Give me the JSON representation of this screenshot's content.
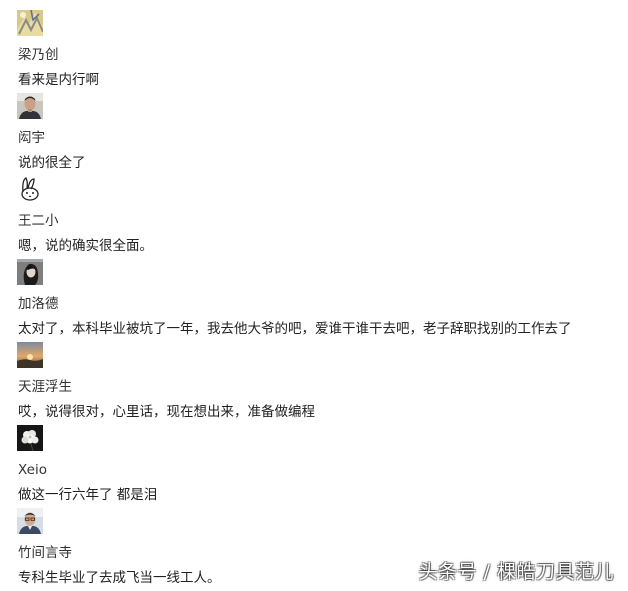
{
  "comments": [
    {
      "username": "梁乃创",
      "text": "看来是内行啊",
      "avatar_icon": "yellow-pattern-avatar-icon"
    },
    {
      "username": "闳宇",
      "text": "说的很全了",
      "avatar_icon": "man-portrait-avatar-icon"
    },
    {
      "username": "王二小",
      "text": "嗯，说的确实很全面。",
      "avatar_icon": "rabbit-sketch-avatar-icon"
    },
    {
      "username": "加洛德",
      "text": "太对了，本科毕业被坑了一年，我去他大爷的吧，爱谁干谁干去吧，老子辞职找别的工作去了",
      "avatar_icon": "woman-portrait-avatar-icon"
    },
    {
      "username": "天涯浮生",
      "text": "哎，说得很对，心里话，现在想出来，准备做编程",
      "avatar_icon": "sunset-landscape-avatar-icon"
    },
    {
      "username": "Xeio",
      "text": "做这一行六年了 都是泪",
      "avatar_icon": "white-flower-avatar-icon"
    },
    {
      "username": "竹间言寺",
      "text": "专科生毕业了去成飞当一线工人。",
      "avatar_icon": "man-glasses-avatar-icon"
    }
  ],
  "watermark": "头条号 / 棵皓刀具范儿",
  "colors": {
    "background": "#ffffff",
    "username": "#333333",
    "comment_text": "#222222",
    "watermark": "#ffffff"
  }
}
